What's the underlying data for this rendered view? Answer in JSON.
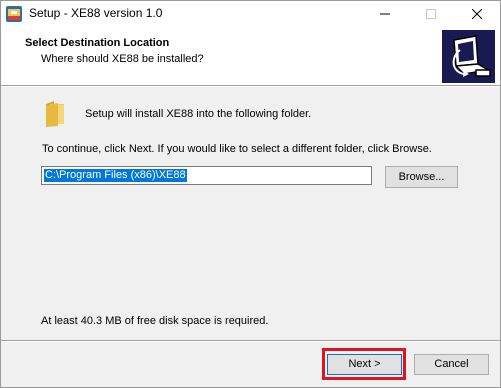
{
  "window": {
    "title": "Setup - XE88 version 1.0",
    "icons": {
      "app": "installer-app-icon",
      "minimize": "minimize-icon",
      "maximize": "maximize-icon",
      "close": "close-icon"
    }
  },
  "header": {
    "title": "Select Destination Location",
    "subtitle": "Where should XE88 be installed?",
    "logo": "computer-install-logo"
  },
  "body": {
    "folder_icon": "folder-icon",
    "install_text": "Setup will install XE88 into the following folder.",
    "continue_text": "To continue, click Next. If you would like to select a different folder, click Browse.",
    "path_value": "C:\\Program Files (x86)\\XE88",
    "browse_label": "Browse...",
    "space_text": "At least 40.3 MB of free disk space is required."
  },
  "footer": {
    "next_label": "Next >",
    "cancel_label": "Cancel",
    "highlight_color": "#e0141f"
  },
  "colors": {
    "selection": "#0078d7",
    "button_face": "#e1e1e1",
    "dialog_bg": "#f0f0f0",
    "logo_bg": "#1a1a52"
  }
}
